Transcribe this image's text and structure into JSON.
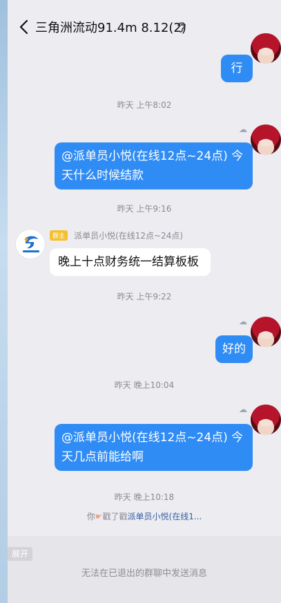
{
  "header": {
    "title": "三角洲流动91.4m   8.12(2)"
  },
  "messages": [
    {
      "text": "行"
    },
    {
      "time": "昨天 上午8:02"
    },
    {
      "text": "@派单员小悦(在线12点~24点) 今天什么时候结款"
    },
    {
      "time": "昨天 上午9:16"
    },
    {
      "role": "群主",
      "sender": "派单员小悦(在线12点~24点)",
      "text": "晚上十点财务统一结算板板"
    },
    {
      "time": "昨天 上午9:22"
    },
    {
      "text": "好的"
    },
    {
      "time": "昨天 晚上10:04"
    },
    {
      "text": "@派单员小悦(在线12点~24点) 今天几点前能给啊"
    },
    {
      "time": "昨天 晚上10:18"
    }
  ],
  "poke": {
    "prefix": "你",
    "action": "戳了戳",
    "target": "派单员小悦(在线1..."
  },
  "bottom": {
    "expand_label": "展开",
    "notice": "无法在已退出的群聊中发送消息"
  },
  "colors": {
    "bubble_out": "#2f8cf5",
    "bubble_in": "#ffffff",
    "background": "#ececf1"
  }
}
